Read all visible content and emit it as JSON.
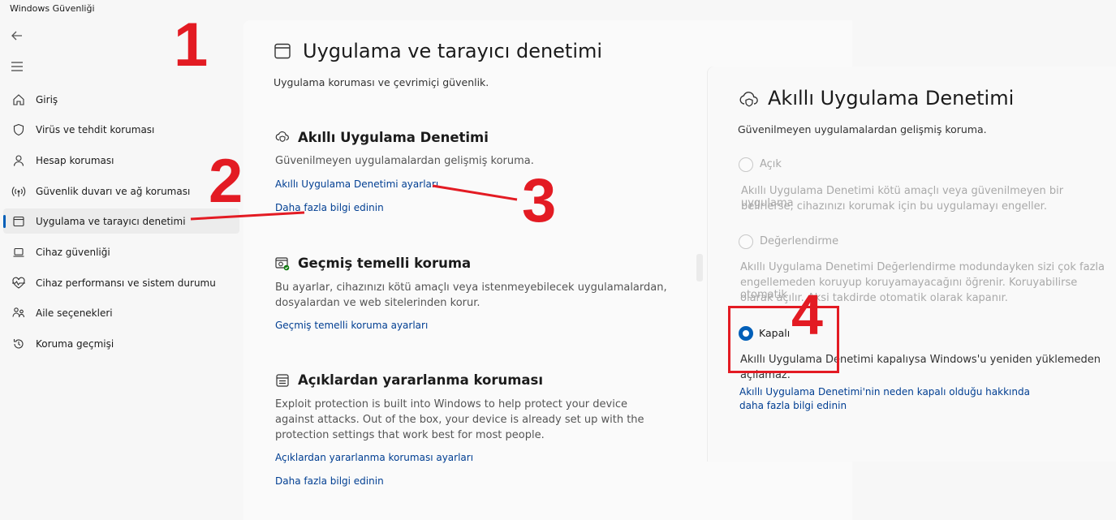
{
  "window": {
    "title": "Windows Güvenliği"
  },
  "sidebar": {
    "items": [
      {
        "label": "Giriş",
        "icon": "home-icon"
      },
      {
        "label": "Virüs ve tehdit koruması",
        "icon": "shield-icon"
      },
      {
        "label": "Hesap koruması",
        "icon": "person-icon"
      },
      {
        "label": "Güvenlik duvarı ve ağ koruması",
        "icon": "wireless-icon"
      },
      {
        "label": "Uygulama ve tarayıcı denetimi",
        "icon": "app-window-icon",
        "active": true
      },
      {
        "label": "Cihaz güvenliği",
        "icon": "laptop-icon"
      },
      {
        "label": "Cihaz performansı ve sistem durumu",
        "icon": "heart-pulse-icon"
      },
      {
        "label": "Aile seçenekleri",
        "icon": "family-icon"
      },
      {
        "label": "Koruma geçmişi",
        "icon": "history-icon"
      }
    ]
  },
  "main": {
    "title": "Uygulama ve tarayıcı denetimi",
    "subtitle": "Uygulama koruması ve çevrimiçi güvenlik.",
    "smart_app": {
      "title": "Akıllı Uygulama Denetimi",
      "desc": "Güvenilmeyen uygulamalardan gelişmiş koruma.",
      "settings_link": "Akıllı Uygulama Denetimi ayarları",
      "learn_link": "Daha fazla bilgi edinin"
    },
    "reputation": {
      "title": "Geçmiş temelli koruma",
      "desc_line1": "Bu ayarlar, cihazınızı kötü amaçlı veya istenmeyebilecek uygulamalardan,",
      "desc_line2": "dosyalardan ve web sitelerinden korur.",
      "settings_link": "Geçmiş temelli koruma ayarları"
    },
    "exploit": {
      "title": "Açıklardan yararlanma koruması",
      "desc_line1": "Exploit protection is built into Windows to help protect your device",
      "desc_line2": "against attacks. Out of the box, your device is already set up with the",
      "desc_line3": "protection settings that work best for most people.",
      "settings_link": "Açıklardan yararlanma koruması ayarları",
      "learn_link": "Daha fazla bilgi edinin"
    }
  },
  "panel": {
    "title": "Akıllı Uygulama Denetimi",
    "subtitle": "Güvenilmeyen uygulamalardan gelişmiş koruma.",
    "opt_on": {
      "label": "Açık",
      "desc_line1": "Akıllı Uygulama Denetimi kötü amaçlı veya güvenilmeyen bir uygulama",
      "desc_line2": "belirlerse, cihazınızı korumak için bu uygulamayı engeller."
    },
    "opt_eval": {
      "label": "Değerlendirme",
      "desc_line1": "Akıllı Uygulama Denetimi Değerlendirme modundayken sizi çok fazla",
      "desc_line2": "engellemeden koruyup koruyamayacağını öğrenir. Koruyabilirse otomatik",
      "desc_line3": "olarak açılır. Aksi takdirde otomatik olarak kapanır."
    },
    "opt_off": {
      "label": "Kapalı",
      "desc_line1": "Akıllı Uygulama Denetimi kapalıysa Windows'u yeniden yüklemeden",
      "desc_line2": "açılamaz.",
      "link_line1": "Akıllı Uygulama Denetimi'nin neden kapalı olduğu hakkında",
      "link_line2": "daha fazla bilgi edinin"
    },
    "selected": "Kapalı"
  },
  "annotations": {
    "n1": "1",
    "n2": "2",
    "n3": "3",
    "n4": "4"
  },
  "colors": {
    "accent": "#005fb8",
    "link": "#003e92",
    "annotation": "#e31b23"
  }
}
